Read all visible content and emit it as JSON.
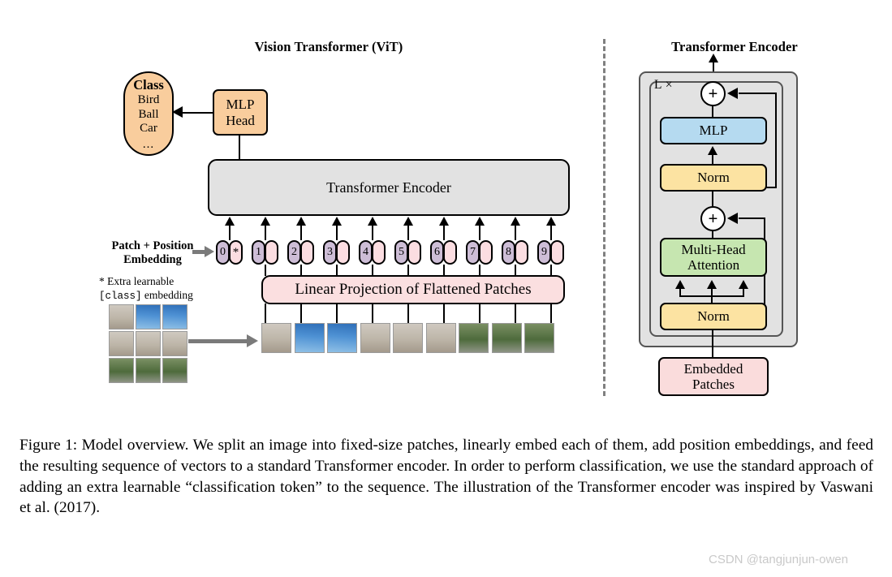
{
  "figure": {
    "left_panel_title": "Vision Transformer (ViT)",
    "right_panel_title": "Transformer Encoder"
  },
  "class_head": {
    "title": "Class",
    "items": [
      "Bird",
      "Ball",
      "Car"
    ],
    "ellipsis": "...",
    "mlp_head_line1": "MLP",
    "mlp_head_line2": "Head"
  },
  "vit": {
    "encoder_label": "Transformer Encoder",
    "linear_projection_label": "Linear Projection of Flattened Patches",
    "embedding_label_line1": "Patch + Position",
    "embedding_label_line2": "Embedding",
    "footnote_marker": "*",
    "footnote_line1": "Extra learnable",
    "footnote_mono": "[class]",
    "footnote_line2_tail": " embedding",
    "tokens": [
      {
        "num": "0",
        "star": "*"
      },
      {
        "num": "1",
        "star": ""
      },
      {
        "num": "2",
        "star": ""
      },
      {
        "num": "3",
        "star": ""
      },
      {
        "num": "4",
        "star": ""
      },
      {
        "num": "5",
        "star": ""
      },
      {
        "num": "6",
        "star": ""
      },
      {
        "num": "7",
        "star": ""
      },
      {
        "num": "8",
        "star": ""
      },
      {
        "num": "9",
        "star": ""
      }
    ],
    "num_encoder_arrows": 10,
    "source_grid_rows": 3,
    "source_grid_cols": 3,
    "patch_strip_count": 9
  },
  "encoder": {
    "repeat_label": "L ×",
    "mlp_label": "MLP",
    "norm_top_label": "Norm",
    "attention_line1": "Multi-Head",
    "attention_line2": "Attention",
    "norm_bottom_label": "Norm",
    "embedded_line1": "Embedded",
    "embedded_line2": "Patches",
    "plus_symbol": "+"
  },
  "caption": {
    "text": "Figure 1: Model overview. We split an image into fixed-size patches, linearly embed each of them, add position embeddings, and feed the resulting sequence of vectors to a standard Transformer encoder. In order to perform classification, we use the standard approach of adding an extra learnable “classification token” to the sequence. The illustration of the Transformer encoder was inspired by Vaswani et al. (2017)."
  },
  "watermark": {
    "text": "CSDN @tangjunjun-owen"
  },
  "colors": {
    "orange": "#f9cd9d",
    "gray": "#e2e2e2",
    "pink": "#fbdfe0",
    "blue": "#b5daf0",
    "yellow": "#fce3a2",
    "green": "#c6e6b0",
    "purple": "#cdbdd6",
    "divider": "#808080",
    "watermark": "#c9c9c9"
  }
}
